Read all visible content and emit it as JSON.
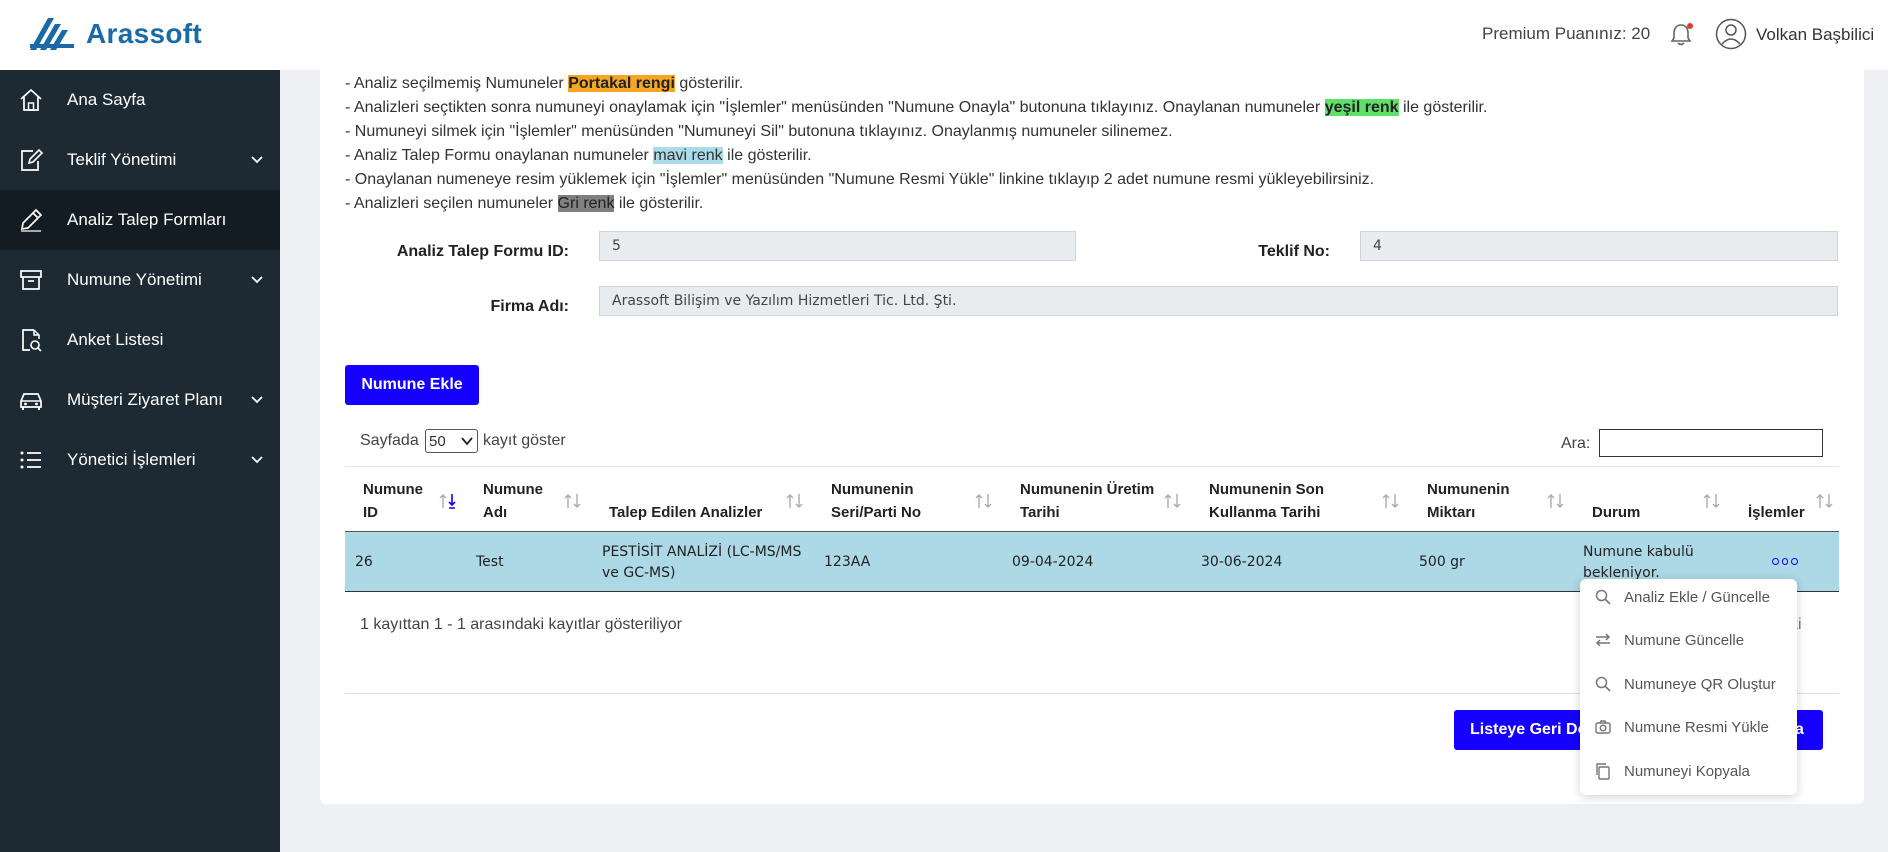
{
  "header": {
    "brand": "Arassoft",
    "premium": "Premium Puanınız: 20",
    "user_name": "Volkan Başbilici",
    "brand_color": "#1a6aa8"
  },
  "sidebar": {
    "items": [
      {
        "label": "Ana Sayfa",
        "icon": "home-icon",
        "has_submenu": false,
        "active": false
      },
      {
        "label": "Teklif Yönetimi",
        "icon": "edit-document-icon",
        "has_submenu": true,
        "active": false
      },
      {
        "label": "Analiz Talep Formları",
        "icon": "pencil-icon",
        "has_submenu": false,
        "active": true
      },
      {
        "label": "Numune Yönetimi",
        "icon": "archive-box-icon",
        "has_submenu": true,
        "active": false
      },
      {
        "label": "Anket Listesi",
        "icon": "survey-document-icon",
        "has_submenu": false,
        "active": false
      },
      {
        "label": "Müşteri Ziyaret Planı",
        "icon": "car-icon",
        "has_submenu": true,
        "active": false
      },
      {
        "label": "Yönetici İşlemleri",
        "icon": "list-icon",
        "has_submenu": true,
        "active": false
      }
    ],
    "background": "#1e2a33"
  },
  "notes": {
    "n1_a": "- Analiz seçilmemiş Numuneler ",
    "n1_hl": "Portakal rengi",
    "n1_b": " gösterilir.",
    "n2_a": "- Analizleri seçtikten sonra numuneyi onaylamak için \"İşlemler\" menüsünden \"Numune Onayla\" butonuna tıklayınız. Onaylanan numuneler ",
    "n2_hl": "yeşil renk",
    "n2_b": " ile gösterilir.",
    "n3": "- Numuneyi silmek için \"İşlemler\" menüsünden \"Numuneyi Sil\" butonuna tıklayınız. Onaylanmış numuneler silinemez.",
    "n4_a": "- Analiz Talep Formu onaylanan numuneler ",
    "n4_hl": "mavi renk",
    "n4_b": " ile gösterilir.",
    "n5": "- Onaylanan numeneye resim yüklemek için \"İşlemler\" menüsünden \"Numune Resmi Yükle\" linkine tıklayıp 2 adet numune resmi yükleyebilirsiniz.",
    "n6_a": "- Analizleri seçilen numuneler ",
    "n6_hl": "Gri renk",
    "n6_b": " ile gösterilir."
  },
  "form": {
    "atf_id_label": "Analiz Talep Formu ID:",
    "atf_id_value": "5",
    "teklif_no_label": "Teklif No:",
    "teklif_no_value": "4",
    "firma_label": "Firma Adı:",
    "firma_value": "Arassoft Bilişim ve Yazılım Hizmetleri Tic. Ltd. Şti."
  },
  "buttons": {
    "add_sample": "Numune Ekle",
    "back_to_list": "Listeye Geri Dö",
    "right_partial": "a"
  },
  "table_controls": {
    "show_prefix": "Sayfada",
    "page_size": "50",
    "show_suffix": "kayıt göster",
    "search_label": "Ara:",
    "search_value": ""
  },
  "table": {
    "columns": [
      {
        "l1": "Numune",
        "l2": "ID"
      },
      {
        "l1": "Numune",
        "l2": "Adı"
      },
      {
        "l1": "",
        "l2": "Talep Edilen Analizler"
      },
      {
        "l1": "Numunenin",
        "l2": "Seri/Parti No"
      },
      {
        "l1": "Numunenin Üretim",
        "l2": "Tarihi"
      },
      {
        "l1": "Numunenin Son",
        "l2": "Kullanma Tarihi"
      },
      {
        "l1": "Numunenin",
        "l2": "Miktarı"
      },
      {
        "l1": "",
        "l2": "Durum"
      },
      {
        "l1": "",
        "l2": "İşlemler"
      }
    ],
    "rows": [
      {
        "id": "26",
        "name": "Test",
        "analyses_l1": "PESTİSİT ANALİZİ (LC-MS/MS",
        "analyses_l2": "ve GC-MS)",
        "lot": "123AA",
        "production": "09-04-2024",
        "expiry": "30-06-2024",
        "amount": "500 gr",
        "status_l1": "Numune kabulü",
        "status_l2": "bekleniyor."
      }
    ],
    "row_color": "#add8e6",
    "info": "1 kayıttan 1 - 1 arasındaki kayıtlar gösteriliyor",
    "pager_fragment": "ki"
  },
  "actions_menu": {
    "items": [
      {
        "label": "Analiz Ekle / Güncelle",
        "icon": "search-icon"
      },
      {
        "label": "Numune Güncelle",
        "icon": "swap-arrows-icon"
      },
      {
        "label": "Numuneye QR Oluştur",
        "icon": "search-icon"
      },
      {
        "label": "Numune Resmi Yükle",
        "icon": "camera-icon"
      },
      {
        "label": "Numuneyi Kopyala",
        "icon": "copy-icon"
      }
    ]
  },
  "accent_color": "#1500ff"
}
